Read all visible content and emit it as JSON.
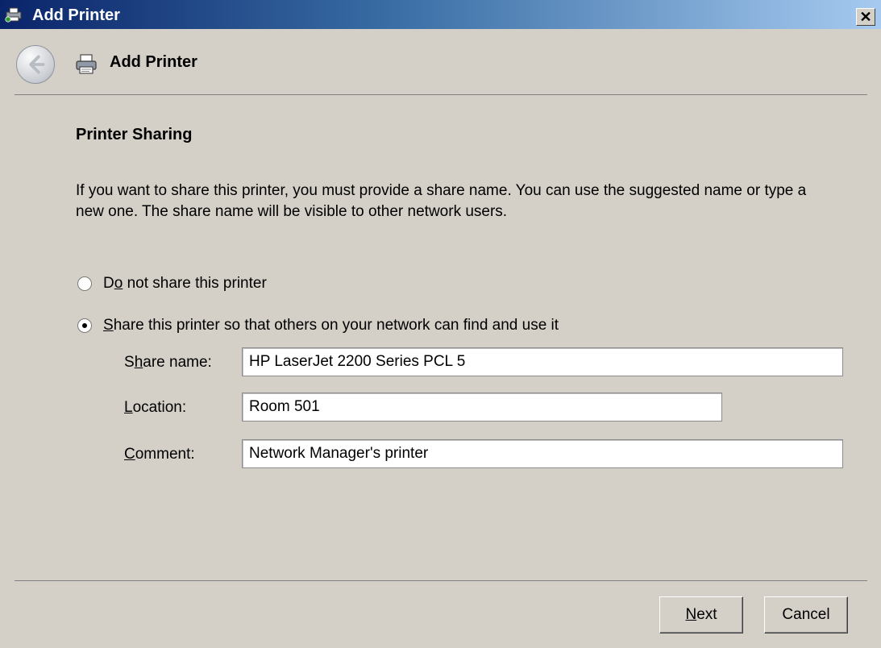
{
  "window": {
    "title": "Add Printer",
    "close_label": "✕"
  },
  "nav": {
    "title": "Add Printer"
  },
  "section": {
    "heading": "Printer Sharing",
    "description": "If you want to share this printer, you must provide a share name. You can use the suggested name or type a new one. The share name will be visible to other network users."
  },
  "options": {
    "do_not_share": {
      "label_pre": "D",
      "label_accel": "o",
      "label_post": " not share this printer",
      "selected": false
    },
    "share": {
      "label_pre": "",
      "label_accel": "S",
      "label_post": "hare this printer so that others on your network can find and use it",
      "selected": true
    }
  },
  "fields": {
    "share_name": {
      "label_pre": "S",
      "label_accel": "h",
      "label_post": "are name:",
      "value": "HP LaserJet 2200 Series PCL 5"
    },
    "location": {
      "label_pre": "",
      "label_accel": "L",
      "label_post": "ocation:",
      "value": "Room 501"
    },
    "comment": {
      "label_pre": "",
      "label_accel": "C",
      "label_post": "omment:",
      "value": "Network Manager's printer"
    }
  },
  "buttons": {
    "next": {
      "label_pre": "",
      "label_accel": "N",
      "label_post": "ext"
    },
    "cancel": {
      "label": "Cancel"
    }
  },
  "icons": {
    "title": "printer-add-icon",
    "nav": "printer-icon",
    "back": "back-arrow-icon"
  }
}
